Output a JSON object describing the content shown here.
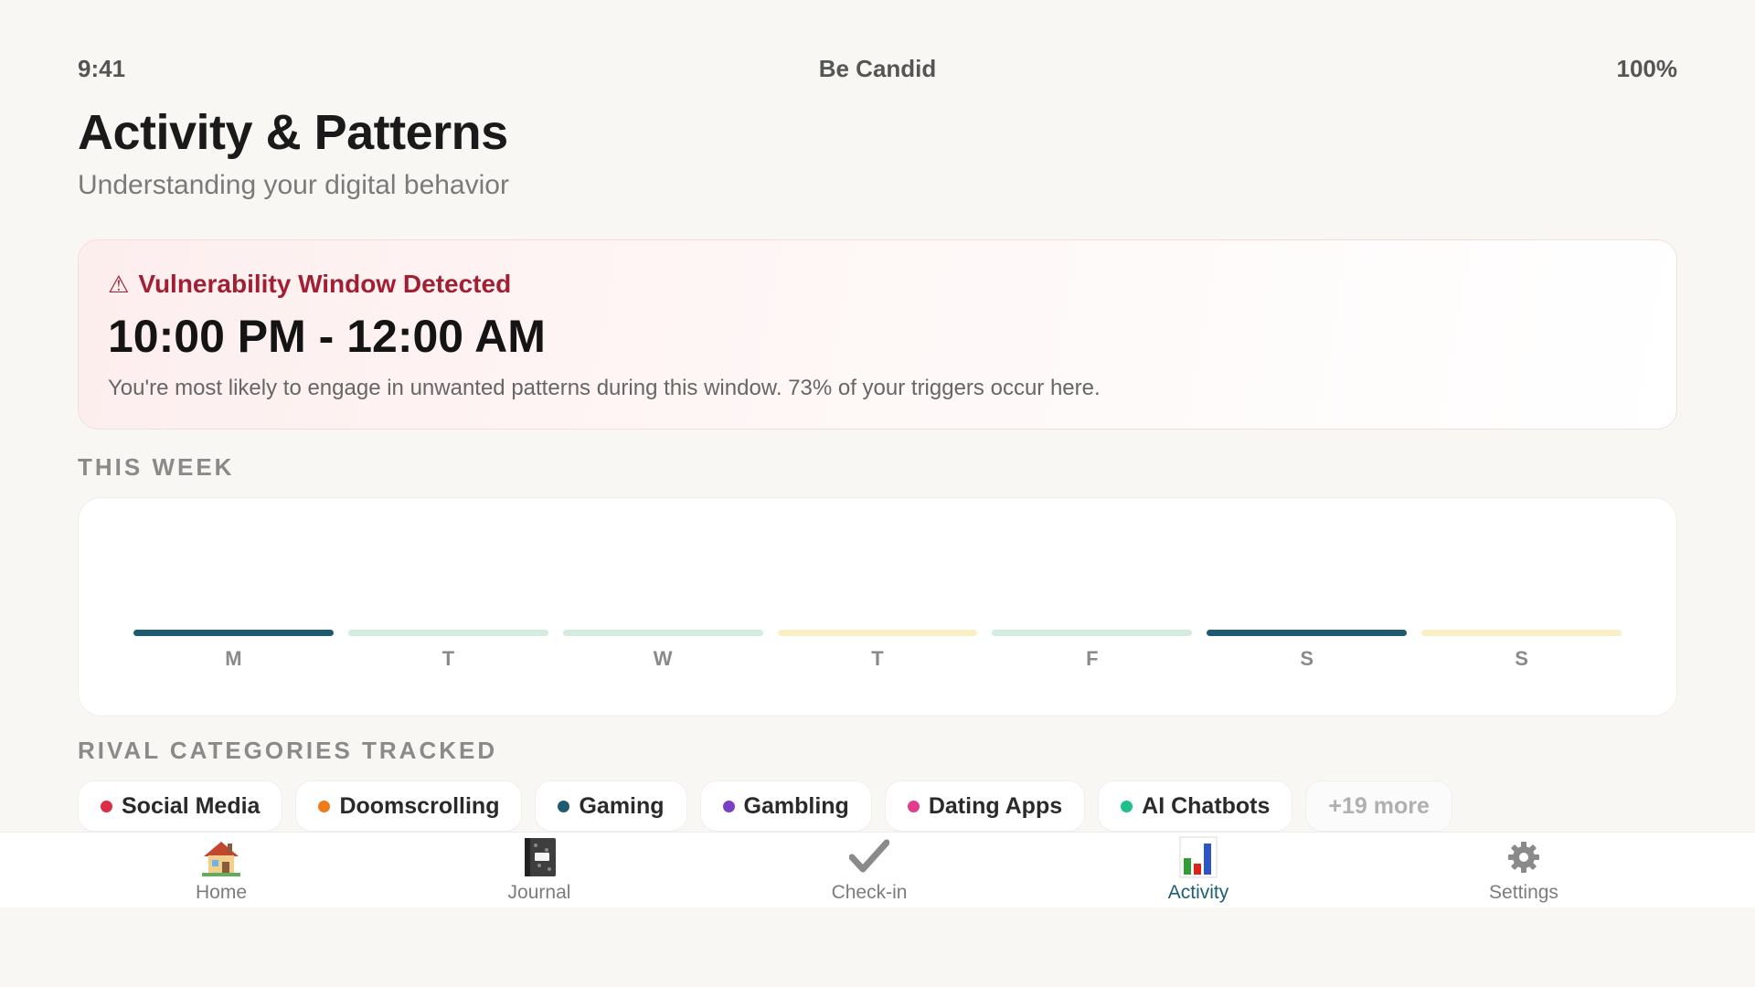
{
  "status_bar": {
    "time": "9:41",
    "app_name": "Be Candid",
    "battery": "100%"
  },
  "header": {
    "title": "Activity & Patterns",
    "subtitle": "Understanding your digital behavior"
  },
  "alert": {
    "icon": "warning-triangle-icon",
    "title": "Vulnerability Window Detected",
    "time_range": "10:00 PM - 12:00 AM",
    "description": "You're most likely to engage in unwanted patterns during this window. 73% of your triggers occur here.",
    "color": "#a11f33"
  },
  "week": {
    "label": "THIS WEEK",
    "days": [
      {
        "label": "M",
        "color": "#1f5b70"
      },
      {
        "label": "T",
        "color": "#d3ecdd"
      },
      {
        "label": "W",
        "color": "#d3ecdd"
      },
      {
        "label": "T",
        "color": "#fbefc6"
      },
      {
        "label": "F",
        "color": "#d3ecdd"
      },
      {
        "label": "S",
        "color": "#1f5b70"
      },
      {
        "label": "S",
        "color": "#fbefc6"
      }
    ]
  },
  "rivals": {
    "label": "RIVAL CATEGORIES TRACKED",
    "items": [
      {
        "label": "Social Media",
        "color": "#dc2f45"
      },
      {
        "label": "Doomscrolling",
        "color": "#f07a1a"
      },
      {
        "label": "Gaming",
        "color": "#1f5b70"
      },
      {
        "label": "Gambling",
        "color": "#7a3fc4"
      },
      {
        "label": "Dating Apps",
        "color": "#e23c8c"
      },
      {
        "label": "AI Chatbots",
        "color": "#1fbf8a"
      }
    ],
    "more_label": "+19 more"
  },
  "tabs": [
    {
      "label": "Home",
      "icon": "house-icon"
    },
    {
      "label": "Journal",
      "icon": "notebook-icon"
    },
    {
      "label": "Check-in",
      "icon": "checkmark-icon"
    },
    {
      "label": "Activity",
      "icon": "bar-chart-icon",
      "active": true
    },
    {
      "label": "Settings",
      "icon": "gear-icon"
    }
  ],
  "accent_color": "#1d5f73"
}
